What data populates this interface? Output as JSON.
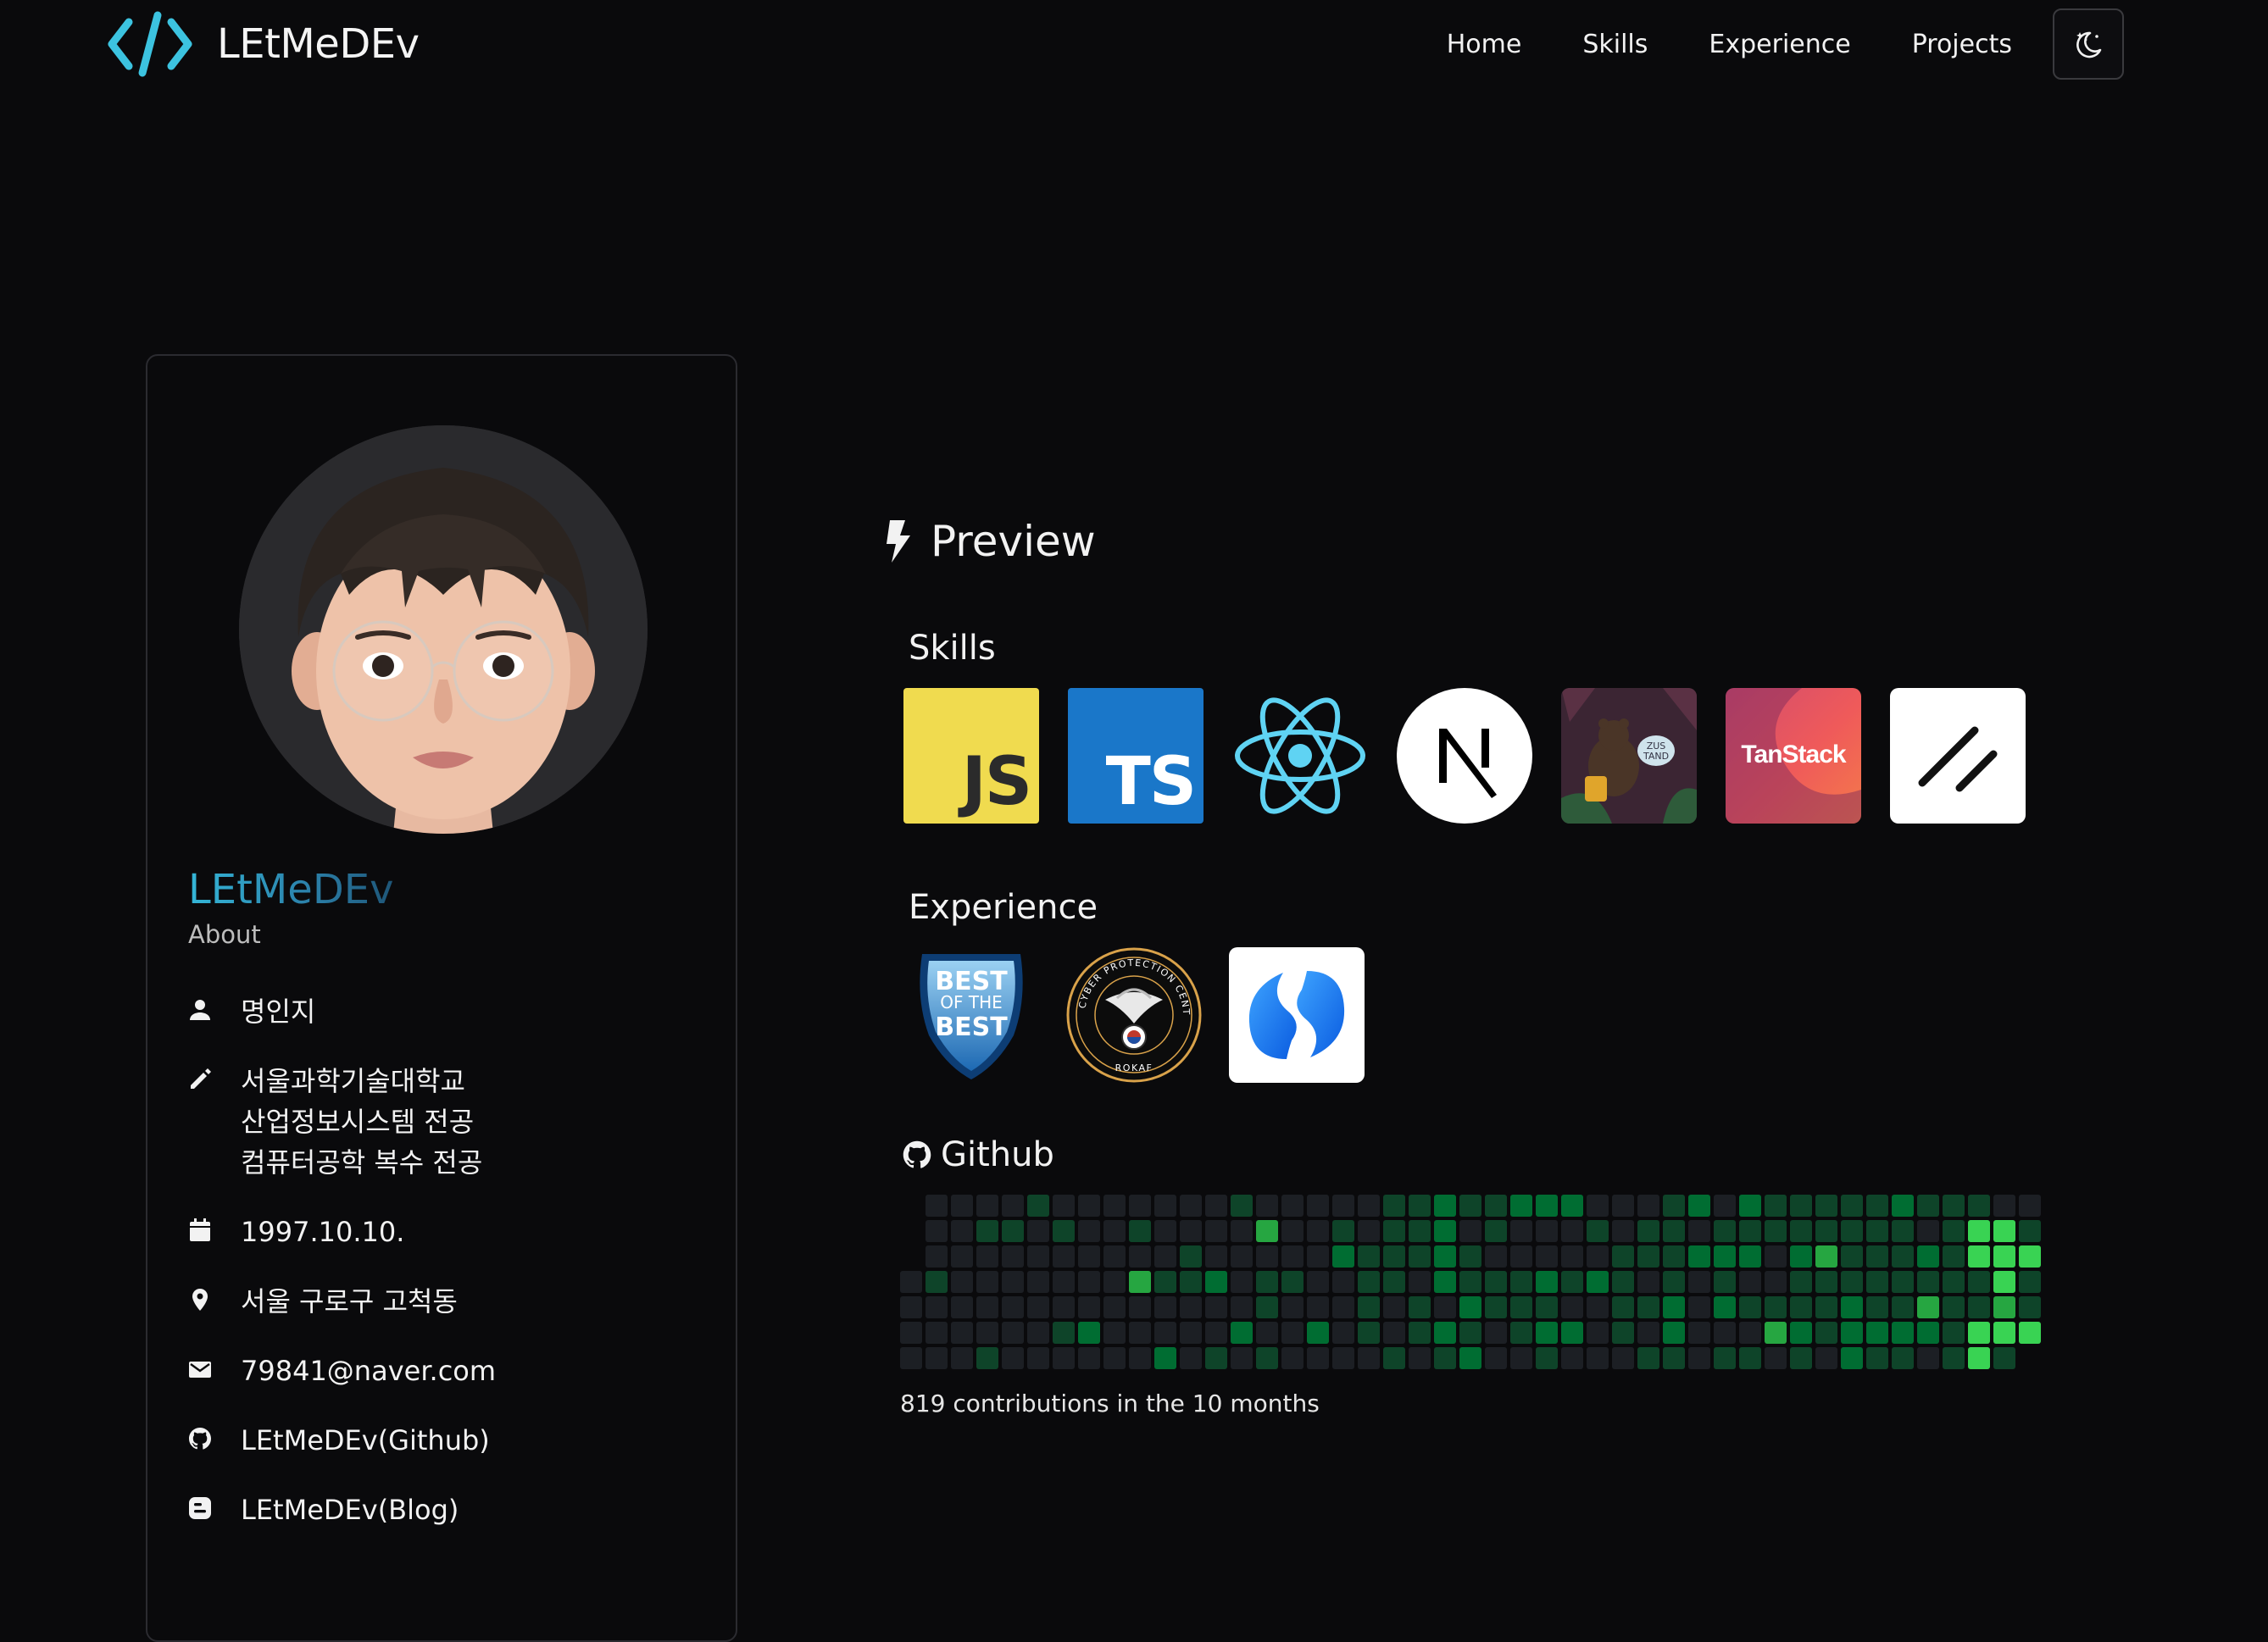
{
  "header": {
    "logo_text": "LEtMeDEv",
    "nav": [
      "Home",
      "Skills",
      "Experience",
      "Projects"
    ],
    "theme_icon": "moon-stars-icon"
  },
  "profile": {
    "name": "LEtMeDEv",
    "about": "About",
    "items": [
      {
        "icon": "person-icon",
        "text": "명인지"
      },
      {
        "icon": "pencil-icon",
        "text": "서울과학기술대학교\n산업정보시스템 전공\n컴퓨터공학 복수 전공"
      },
      {
        "icon": "calendar-icon",
        "text": "1997.10.10."
      },
      {
        "icon": "location-pin-icon",
        "text": "서울 구로구 고척동"
      },
      {
        "icon": "mail-icon",
        "text": "79841@naver.com"
      },
      {
        "icon": "github-icon",
        "text": "LEtMeDEv(Github)"
      },
      {
        "icon": "blog-icon",
        "text": "LEtMeDEv(Blog)"
      }
    ]
  },
  "preview": {
    "title": "Preview",
    "skills_label": "Skills",
    "skills": [
      {
        "name": "javascript-logo",
        "label": "JS"
      },
      {
        "name": "typescript-logo",
        "label": "TS"
      },
      {
        "name": "react-logo",
        "label": ""
      },
      {
        "name": "nextjs-logo",
        "label": ""
      },
      {
        "name": "zustand-logo",
        "label": ""
      },
      {
        "name": "tanstack-logo",
        "label": "TanStack"
      },
      {
        "name": "shadcn-logo",
        "label": ""
      }
    ],
    "experience_label": "Experience",
    "experience": [
      {
        "name": "best-of-the-best-logo",
        "lines": [
          "BEST",
          "OF THE",
          "BEST"
        ]
      },
      {
        "name": "rokaf-cyber-protection-center-logo",
        "ring_text": "CYBER PROTECTION CENTER",
        "bottom_text": "ROKAF"
      },
      {
        "name": "blue-swirl-logo"
      }
    ],
    "github_label": "Github",
    "contributions_text": "819 contributions in the 10 months"
  },
  "colors": {
    "background": "#0a0a0c",
    "accent": "#34b6d8",
    "contrib_levels": [
      "#1c1f24",
      "#0e4429",
      "#006d32",
      "#26a641",
      "#39d353"
    ]
  }
}
